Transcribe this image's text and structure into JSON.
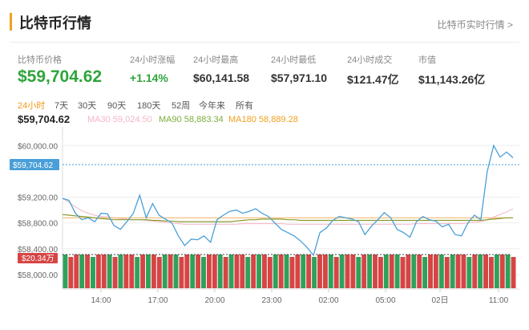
{
  "header": {
    "title": "比特币行情",
    "link": "比特币实时行情 >"
  },
  "stats": [
    {
      "label": "比特币价格",
      "value": "$59,704.62"
    },
    {
      "label": "24小时涨幅",
      "value": "+1.14%"
    },
    {
      "label": "24小时最高",
      "value": "$60,141.58"
    },
    {
      "label": "24小时最低",
      "value": "$57,971.10"
    },
    {
      "label": "24小时成交",
      "value": "$121.47亿"
    },
    {
      "label": "市值",
      "value": "$11,143.26亿"
    }
  ],
  "tabs": [
    "24小时",
    "7天",
    "30天",
    "90天",
    "180天",
    "52周",
    "今年来",
    "所有"
  ],
  "active_tab": "24小时",
  "current_price": "$59,704.62",
  "ma": [
    {
      "label": "MA30 59,024.50",
      "color": "#f4b6c6"
    },
    {
      "label": "MA90 58,883.34",
      "color": "#7cad3c"
    },
    {
      "label": "MA180 58,889.28",
      "color": "#f0a01e"
    }
  ],
  "chart_data": {
    "type": "line",
    "ylim": [
      57900,
      60140
    ],
    "yticks": [
      "$60,000.00",
      "$59,200.00",
      "$58,800.00",
      "$58,400.00",
      "$58,000.00"
    ],
    "ytick_values": [
      60000,
      59200,
      58800,
      58400,
      58000
    ],
    "xticks": [
      "14:00",
      "17:00",
      "20:00",
      "23:00",
      "02:00",
      "05:00",
      "02日",
      "11:00"
    ],
    "current_label": "$59,704.62",
    "current_value": 59704.62,
    "volume_label": "$20.34万",
    "price": [
      59180,
      59150,
      58950,
      58850,
      58880,
      58820,
      58950,
      58940,
      58760,
      58700,
      58820,
      58950,
      59230,
      58880,
      59100,
      58920,
      58860,
      58800,
      58600,
      58450,
      58550,
      58540,
      58600,
      58500,
      58850,
      58920,
      58980,
      59000,
      58950,
      58980,
      59020,
      58950,
      58900,
      58800,
      58700,
      58650,
      58600,
      58520,
      58420,
      58300,
      58650,
      58720,
      58840,
      58900,
      58880,
      58860,
      58820,
      58620,
      58750,
      58850,
      58960,
      58880,
      58700,
      58650,
      58580,
      58820,
      58900,
      58850,
      58830,
      58740,
      58780,
      58620,
      58600,
      58800,
      58920,
      58850,
      59600,
      60000,
      59820,
      59900,
      59810
    ],
    "ma30": [
      59180,
      59120,
      59050,
      58990,
      58950,
      58920,
      58900,
      58890,
      58880,
      58870,
      58860,
      58850,
      58850,
      58840,
      58830,
      58820,
      58810,
      58800,
      58790,
      58780,
      58780,
      58780,
      58780,
      58780,
      58780,
      58780,
      58780,
      58780,
      58790,
      58790,
      58790,
      58790,
      58790,
      58790,
      58790,
      58780,
      58780,
      58780,
      58780,
      58780,
      58780,
      58780,
      58780,
      58780,
      58780,
      58780,
      58780,
      58780,
      58780,
      58780,
      58780,
      58780,
      58780,
      58780,
      58780,
      58790,
      58790,
      58790,
      58790,
      58790,
      58790,
      58790,
      58790,
      58800,
      58810,
      58820,
      58850,
      58890,
      58930,
      58970,
      59020
    ],
    "ma90": [
      58930,
      58920,
      58910,
      58900,
      58890,
      58880,
      58870,
      58860,
      58850,
      58850,
      58850,
      58850,
      58850,
      58850,
      58840,
      58840,
      58830,
      58830,
      58820,
      58820,
      58820,
      58820,
      58820,
      58820,
      58820,
      58820,
      58820,
      58830,
      58840,
      58850,
      58850,
      58860,
      58860,
      58860,
      58860,
      58850,
      58850,
      58840,
      58840,
      58840,
      58840,
      58840,
      58840,
      58840,
      58840,
      58840,
      58840,
      58840,
      58840,
      58840,
      58840,
      58840,
      58840,
      58840,
      58840,
      58840,
      58840,
      58840,
      58840,
      58840,
      58840,
      58840,
      58840,
      58840,
      58840,
      58840,
      58850,
      58860,
      58870,
      58880,
      58880
    ],
    "ma180": [
      58880,
      58880,
      58880,
      58880,
      58880,
      58880,
      58880,
      58880,
      58880,
      58880,
      58880,
      58880,
      58880,
      58880,
      58880,
      58880,
      58880,
      58880,
      58880,
      58880,
      58880,
      58880,
      58880,
      58880,
      58880,
      58880,
      58880,
      58880,
      58880,
      58880,
      58880,
      58880,
      58880,
      58880,
      58880,
      58880,
      58880,
      58880,
      58880,
      58880,
      58880,
      58880,
      58880,
      58880,
      58880,
      58880,
      58880,
      58880,
      58880,
      58880,
      58880,
      58880,
      58880,
      58880,
      58880,
      58880,
      58880,
      58880,
      58880,
      58880,
      58880,
      58880,
      58880,
      58880,
      58880,
      58880,
      58880,
      58880,
      58880,
      58880,
      58880
    ],
    "colors": {
      "price": "#4a9fd8",
      "up": "#d64545",
      "down": "#2fa15a",
      "grid": "#eeeeee"
    }
  }
}
